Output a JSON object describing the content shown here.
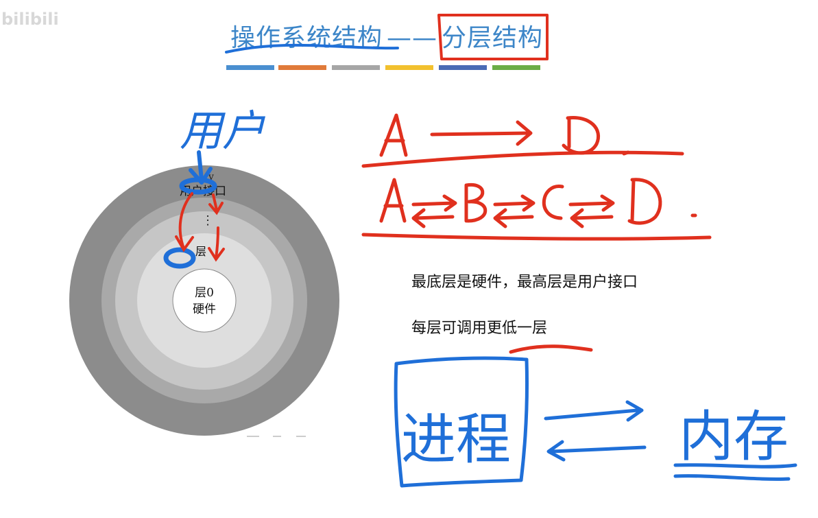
{
  "watermark": "bilibili",
  "title": {
    "part1": "操作系统结构",
    "dash": "——",
    "part2": "分层结构"
  },
  "color_bar": [
    "#4a8fd0",
    "#e07a3a",
    "#a6a6a6",
    "#f2c12e",
    "#4a6bb5",
    "#6bad47"
  ],
  "diagram": {
    "ring_labels": {
      "outer_partial": "v",
      "user_interface_partial": "用户接口",
      "dots": "⋮",
      "middle_partial": "层",
      "core_line1": "层0",
      "core_line2": "硬件"
    },
    "ring_colors": [
      "#8c8c8c",
      "#a9a9a9",
      "#c6c6c6",
      "#dedede",
      "#ffffff"
    ]
  },
  "handwriting": {
    "user_label": "用户",
    "top_formula": [
      "A",
      "D"
    ],
    "chain": [
      "A",
      "B",
      "C",
      "D"
    ],
    "process": "进程",
    "memory": "内存",
    "colors": {
      "red": "#e0301e",
      "blue": "#1f6fd8"
    }
  },
  "notes": {
    "line1": "最底层是硬件，最高层是用户接口",
    "line2_plain": "每层可调用",
    "line2_marked": "更低一层"
  }
}
